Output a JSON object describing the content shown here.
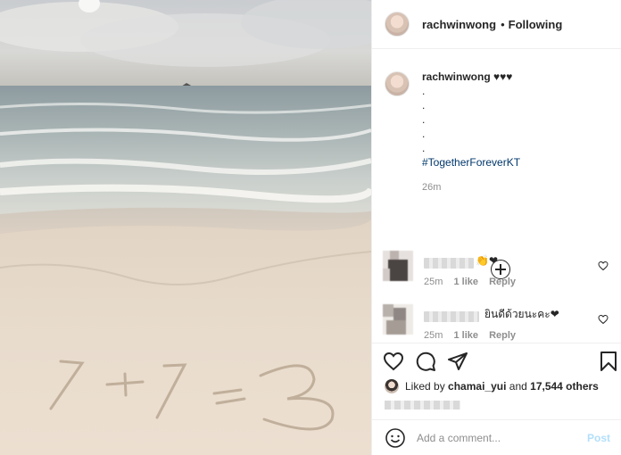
{
  "post": {
    "photo_text": "1+1=3"
  },
  "header": {
    "username": "rachwinwong",
    "separator": "•",
    "follow_status": "Following"
  },
  "caption": {
    "username": "rachwinwong",
    "text": "♥♥♥",
    "dots": [
      ".",
      ".",
      ".",
      ".",
      "."
    ],
    "hashtag": "#TogetherForeverKT",
    "time": "26m"
  },
  "comments": [
    {
      "text": "👏❤",
      "time": "25m",
      "likes": "1 like",
      "reply": "Reply"
    },
    {
      "text": "ยินดีด้วยนะคะ❤",
      "time": "25m",
      "likes": "1 like",
      "reply": "Reply"
    }
  ],
  "likes": {
    "prefix": "Liked by",
    "user": "chamai_yui",
    "and": "and",
    "count": "17,544 others"
  },
  "add_comment": {
    "placeholder": "Add a comment...",
    "post_label": "Post"
  },
  "colors": {
    "link": "#00376b",
    "post_disabled": "#b2dffc",
    "heart": "#ed4956"
  }
}
